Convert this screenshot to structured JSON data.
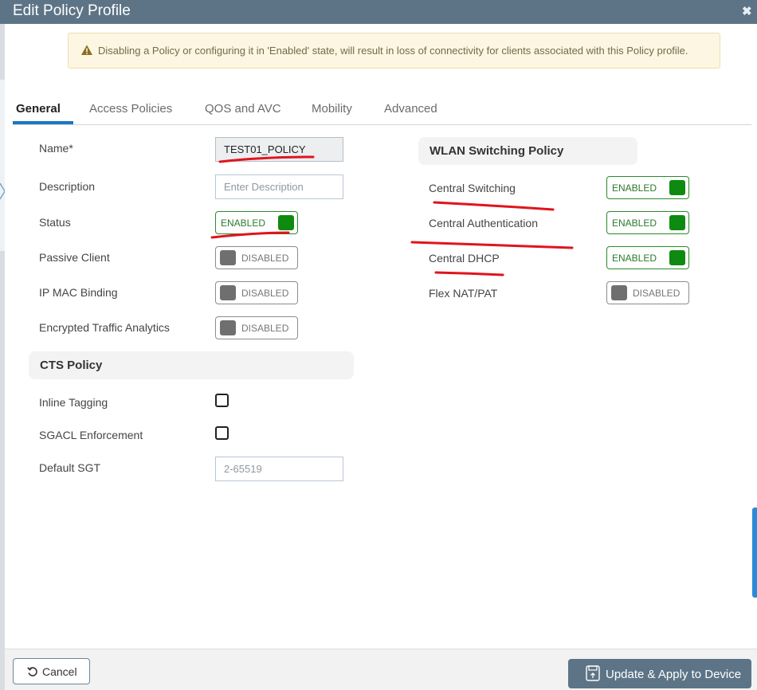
{
  "dialog": {
    "title": "Edit Policy Profile",
    "close_icon": "close-icon"
  },
  "alert": {
    "icon": "warning-icon",
    "text": "Disabling a Policy or configuring it in 'Enabled' state, will result in loss of connectivity for clients associated with this Policy profile."
  },
  "tabs": [
    {
      "label": "General",
      "active": true
    },
    {
      "label": "Access Policies",
      "active": false
    },
    {
      "label": "QOS and AVC",
      "active": false
    },
    {
      "label": "Mobility",
      "active": false
    },
    {
      "label": "Advanced",
      "active": false
    }
  ],
  "general": {
    "name_label": "Name*",
    "name_value": "TEST01_POLICY",
    "description_label": "Description",
    "description_placeholder": "Enter Description",
    "status_label": "Status",
    "status_toggle": "ENABLED",
    "passive_client_label": "Passive Client",
    "passive_client_toggle": "DISABLED",
    "ip_mac_binding_label": "IP MAC Binding",
    "ip_mac_binding_toggle": "DISABLED",
    "eta_label": "Encrypted Traffic Analytics",
    "eta_toggle": "DISABLED"
  },
  "cts": {
    "heading": "CTS Policy",
    "inline_tagging_label": "Inline Tagging",
    "inline_tagging_checked": false,
    "sgacl_label": "SGACL Enforcement",
    "sgacl_checked": false,
    "default_sgt_label": "Default SGT",
    "default_sgt_placeholder": "2-65519"
  },
  "wlan_switching": {
    "heading": "WLAN Switching Policy",
    "central_switching_label": "Central Switching",
    "central_switching_toggle": "ENABLED",
    "central_auth_label": "Central Authentication",
    "central_auth_toggle": "ENABLED",
    "central_dhcp_label": "Central DHCP",
    "central_dhcp_toggle": "ENABLED",
    "flex_nat_label": "Flex NAT/PAT",
    "flex_nat_toggle": "DISABLED"
  },
  "footer": {
    "cancel_label": "Cancel",
    "cancel_icon": "undo-icon",
    "apply_label": "Update & Apply to Device",
    "apply_icon": "save-icon"
  },
  "colors": {
    "header": "#5d7486",
    "tab_accent": "#1b78c2",
    "enabled_green": "#0f8a10",
    "annotation_red": "#e0141e"
  }
}
